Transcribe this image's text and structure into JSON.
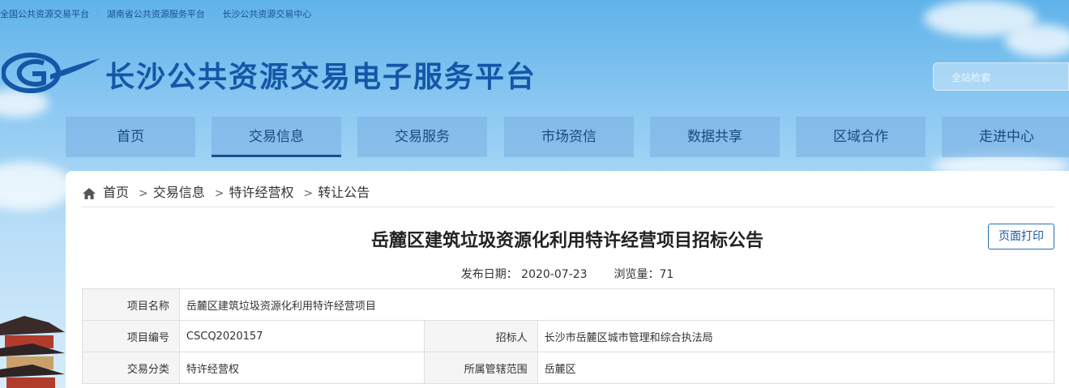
{
  "top_links": [
    "全国公共资源交易平台",
    "湖南省公共资源服务平台",
    "长沙公共资源交易中心"
  ],
  "site": {
    "title": "长沙公共资源交易电子服务平台"
  },
  "search": {
    "placeholder": "全站检索"
  },
  "nav": {
    "items": [
      {
        "label": "首页"
      },
      {
        "label": "交易信息"
      },
      {
        "label": "交易服务"
      },
      {
        "label": "市场资信"
      },
      {
        "label": "数据共享"
      },
      {
        "label": "区域合作"
      },
      {
        "label": "走进中心"
      }
    ],
    "active_index": 1
  },
  "breadcrumb": {
    "home": "首页",
    "items": [
      "交易信息",
      "特许经营权",
      "转让公告"
    ]
  },
  "announcement": {
    "title": "岳麓区建筑垃圾资源化利用特许经营项目招标公告",
    "print_label": "页面打印",
    "publish_label": "发布日期：",
    "publish_date": "2020-07-23",
    "views_label": "浏览量：",
    "views": "71"
  },
  "info_table": {
    "row1": {
      "label": "项目名称",
      "value": "岳麓区建筑垃圾资源化利用特许经营项目"
    },
    "row2": {
      "label": "项目编号",
      "value": "CSCQ2020157",
      "label2": "招标人",
      "value2": "长沙市岳麓区城市管理和综合执法局"
    },
    "row3": {
      "label": "交易分类",
      "value": "特许经营权",
      "label2": "所属管辖范围",
      "value2": "岳麓区"
    }
  },
  "colors": {
    "brand_blue": "#1556a8",
    "nav_active_underline": "#1a4f93",
    "sky": "#8fcaf2"
  }
}
